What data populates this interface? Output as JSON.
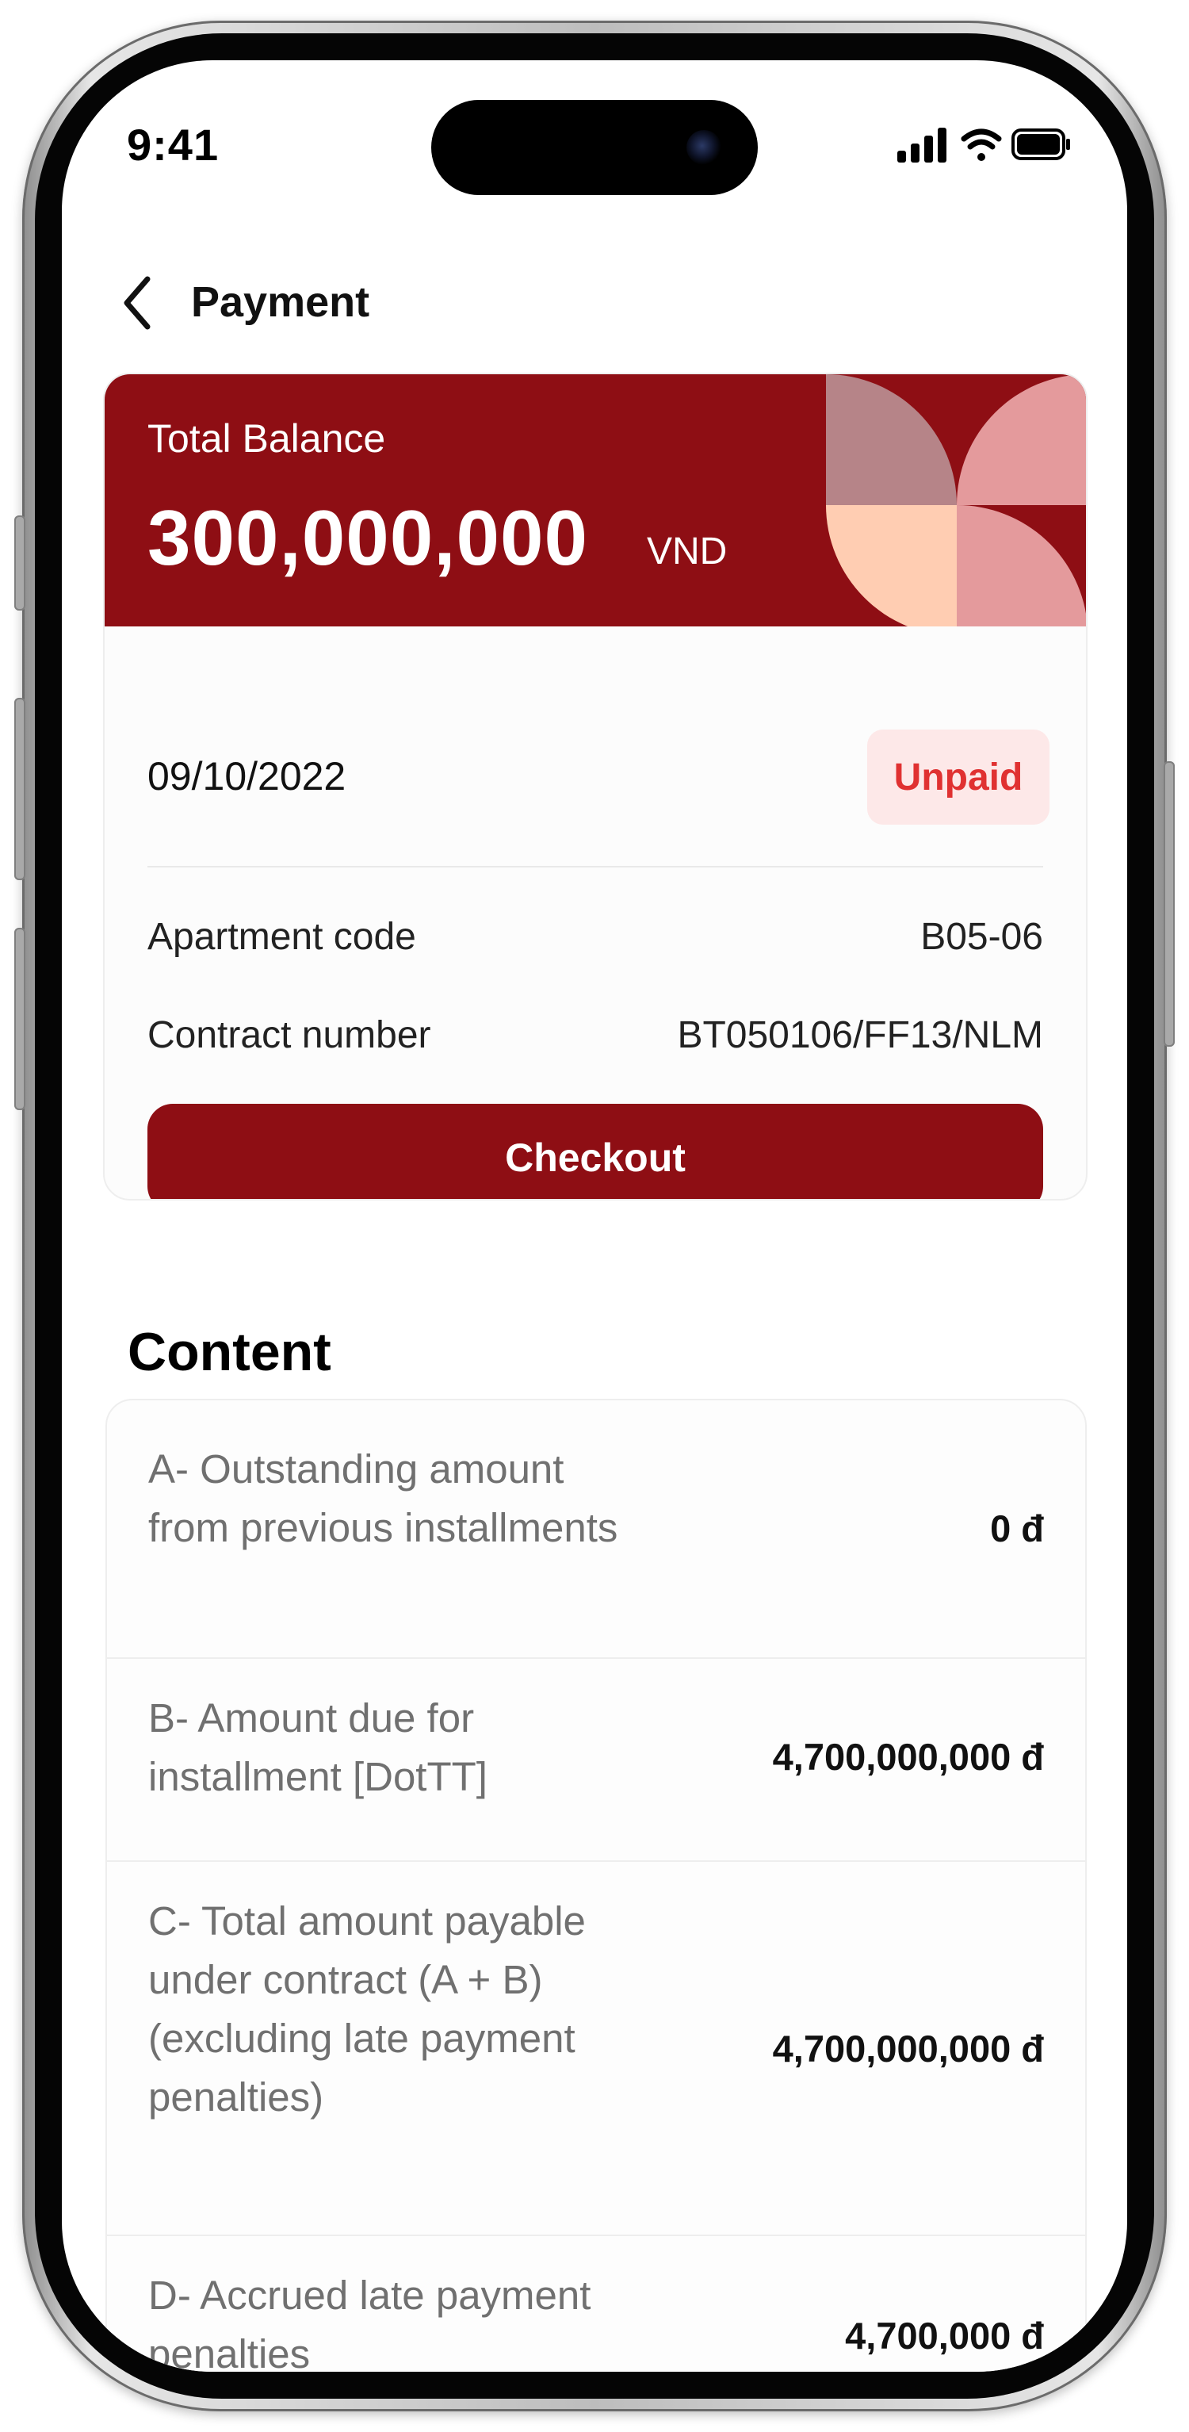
{
  "status_bar": {
    "time": "9:41"
  },
  "header": {
    "title": "Payment"
  },
  "balance_card": {
    "label": "Total Balance",
    "amount": "300,000,000",
    "currency": "VND",
    "date": "09/10/2022",
    "status": "Unpaid",
    "details": [
      {
        "label": "Apartment code",
        "value": "B05-06"
      },
      {
        "label": "Contract number",
        "value": "BT050106/FF13/NLM"
      }
    ],
    "checkout_label": "Checkout"
  },
  "content": {
    "title": "Content",
    "items": [
      {
        "label": "A- Outstanding amount from previous installments",
        "value": "0  đ"
      },
      {
        "label": "B- Amount due for installment [DotTT]",
        "value": "4,700,000,000 đ"
      },
      {
        "label": "C- Total amount payable under contract (A + B) (excluding late payment penalties)",
        "value": "4,700,000,000 đ"
      },
      {
        "label": "D- Accrued late payment penalties",
        "value": "4,700,000 đ"
      }
    ]
  },
  "colors": {
    "brand": "#8e0e14",
    "badge_bg": "#fde8e8",
    "badge_text": "#e03131",
    "pattern_mauve": "#b68488",
    "pattern_pink": "#e49a9c",
    "pattern_peach": "#ffcdb2"
  }
}
